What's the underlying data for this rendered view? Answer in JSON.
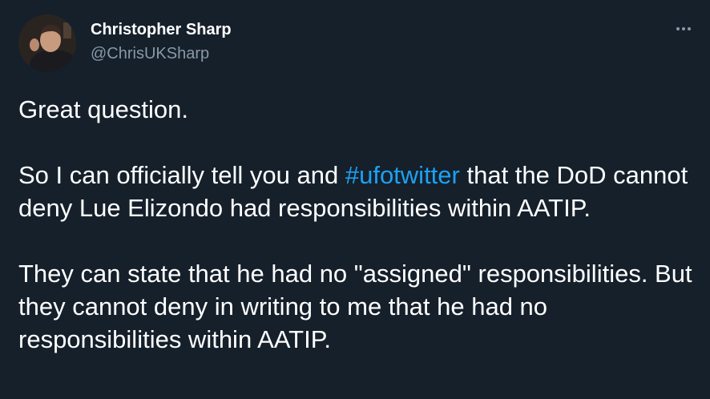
{
  "author": {
    "display_name": "Christopher Sharp",
    "handle": "@ChrisUKSharp"
  },
  "menu": {
    "icon": "more-horizontal-icon"
  },
  "tweet": {
    "line1": "Great question.",
    "para2_before": "So I can officially tell you and ",
    "para2_hashtag": "#ufotwitter",
    "para2_after": " that the DoD cannot deny Lue Elizondo had responsibilities within AATIP.",
    "para3": "They can state that he had no \"assigned\" responsibilities. But they cannot deny in writing to me that he had no responsibilities within AATIP."
  },
  "colors": {
    "background": "#15202b",
    "text": "#ffffff",
    "secondary_text": "#8899a6",
    "link": "#1da1f2"
  }
}
